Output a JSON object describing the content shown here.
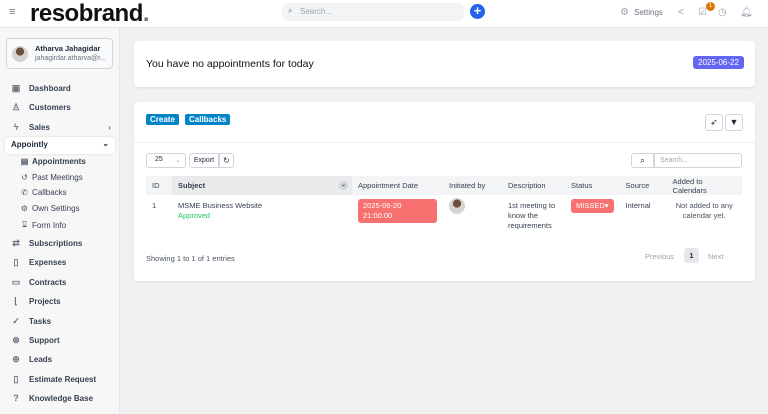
{
  "header": {
    "logo": "resobrand",
    "search_placeholder": "Search...",
    "settings_label": "Settings",
    "tasks_badge": "1"
  },
  "user": {
    "name": "Atharva Jahagidar",
    "email": "jahagirdar.atharva@r..."
  },
  "sidebar": {
    "items": [
      {
        "label": "Dashboard",
        "icon": "dashboard-icon"
      },
      {
        "label": "Customers",
        "icon": "user-icon"
      },
      {
        "label": "Sales",
        "icon": "bolt-icon"
      }
    ],
    "appointly": {
      "label": "Appointly",
      "subitems": [
        {
          "label": "Appointments"
        },
        {
          "label": "Past Meetings"
        },
        {
          "label": "Callbacks"
        },
        {
          "label": "Own Settings"
        },
        {
          "label": "Form Info"
        }
      ]
    },
    "items2": [
      {
        "label": "Subscriptions"
      },
      {
        "label": "Expenses"
      },
      {
        "label": "Contracts"
      },
      {
        "label": "Projects"
      },
      {
        "label": "Tasks"
      },
      {
        "label": "Support"
      },
      {
        "label": "Leads"
      },
      {
        "label": "Estimate Request"
      },
      {
        "label": "Knowledge Base"
      }
    ]
  },
  "today": {
    "message": "You have no appointments for today",
    "date": "2025-06-22"
  },
  "toolbar": {
    "create": "Create",
    "callbacks": "Callbacks",
    "page_size": "25",
    "export": "Export",
    "search_placeholder": "Search..."
  },
  "table": {
    "columns": [
      "ID",
      "Subject",
      "Appointment Date",
      "Initiated by",
      "Description",
      "Status",
      "Source",
      "Added to Calendars"
    ],
    "rows": [
      {
        "id": "1",
        "subject": "MSME Business Website",
        "approval": "Approved",
        "date": "2025-06-20 21:00:00",
        "description": "1st meeting to know the requirements",
        "status": "MISSED",
        "source": "Internal",
        "calendars": "Not added to any calendar yet."
      }
    ]
  },
  "footer": {
    "info": "Showing 1 to 1 of 1 entries",
    "previous": "Previous",
    "page": "1",
    "next": "Next"
  },
  "colors": {
    "accent": "#0284c7",
    "date_badge": "#6366f1",
    "missed": "#f87171",
    "approved": "#22c55e"
  }
}
